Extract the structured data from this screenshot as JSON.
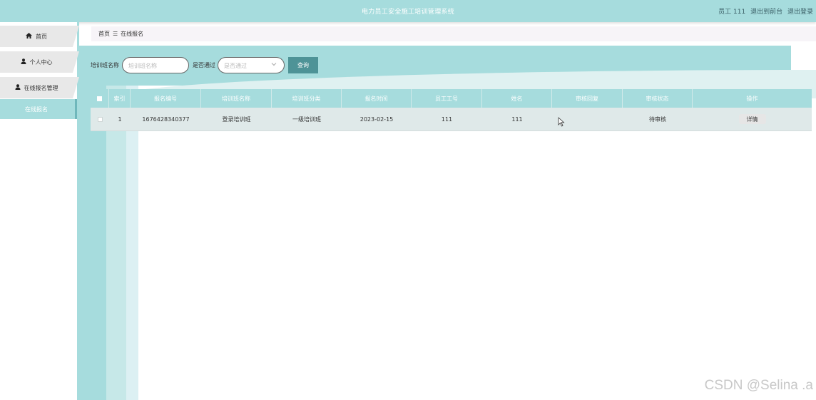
{
  "header": {
    "title": "电力员工安全施工培训管理系统",
    "user_label": "员工 111",
    "back_label": "退出到前台",
    "logout_label": "退出登录",
    "bg_color": "#a6dcdd"
  },
  "sidebar": {
    "items": [
      {
        "label": "首页",
        "icon": "home-icon"
      },
      {
        "label": "个人中心",
        "icon": "user-icon"
      },
      {
        "label": "在线报名管理",
        "icon": "user-icon"
      }
    ],
    "sub_items": [
      {
        "label": "在线报名"
      }
    ]
  },
  "breadcrumb": {
    "home": "首页",
    "separator": "☰",
    "current": "在线报名"
  },
  "search": {
    "class_name_label": "培训班名称",
    "class_name_placeholder": "培训班名称",
    "passed_label": "是否通过",
    "passed_placeholder": "是否通过",
    "query_label": "查询"
  },
  "table": {
    "columns": [
      "索引",
      "报名编号",
      "培训班名称",
      "培训班分类",
      "报名时间",
      "员工工号",
      "姓名",
      "审核回复",
      "审核状态",
      "操作"
    ],
    "rows": [
      {
        "index": "1",
        "reg_no": "1676428340377",
        "class_name": "登录培训班",
        "class_type": "一级培训班",
        "reg_time": "2023-02-15",
        "emp_no": "111",
        "name": "111",
        "reply": "",
        "status": "待审核",
        "action": "详情"
      }
    ]
  },
  "watermark": "CSDN @Selina .a"
}
